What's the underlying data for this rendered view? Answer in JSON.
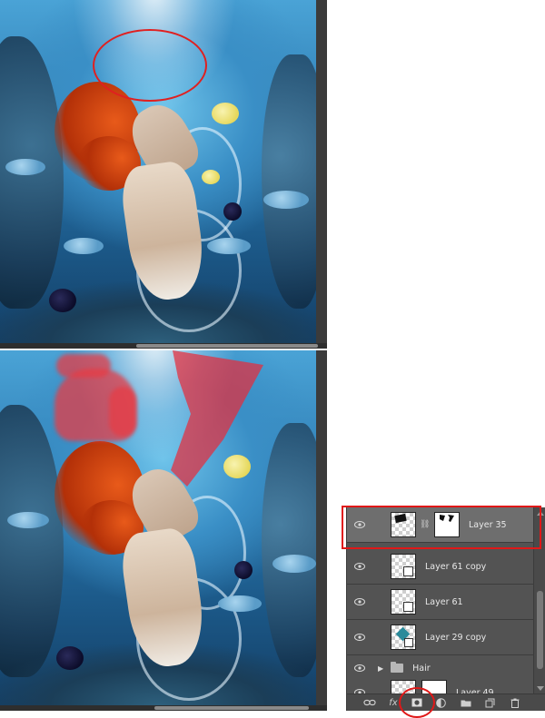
{
  "layers_panel": {
    "layers": [
      {
        "name": "Layer 35",
        "selected": true,
        "has_mask": true
      },
      {
        "name": "Layer 61 copy",
        "selected": false,
        "has_mask": false
      },
      {
        "name": "Layer 61",
        "selected": false,
        "has_mask": false
      },
      {
        "name": "Layer 29 copy",
        "selected": false,
        "has_mask": false
      },
      {
        "name": "Hair",
        "type": "group",
        "selected": false
      },
      {
        "name": "Layer 49",
        "selected": false,
        "has_mask": true
      }
    ],
    "toolbar_icons": [
      "link-icon",
      "fx-icon",
      "add-mask-icon",
      "adjustment-icon",
      "folder-icon",
      "new-layer-icon",
      "trash-icon"
    ],
    "fx_label": "fx"
  },
  "colors": {
    "panel_bg": "#535353",
    "selected_row": "#6e6e6e",
    "highlight": "#e01818"
  }
}
